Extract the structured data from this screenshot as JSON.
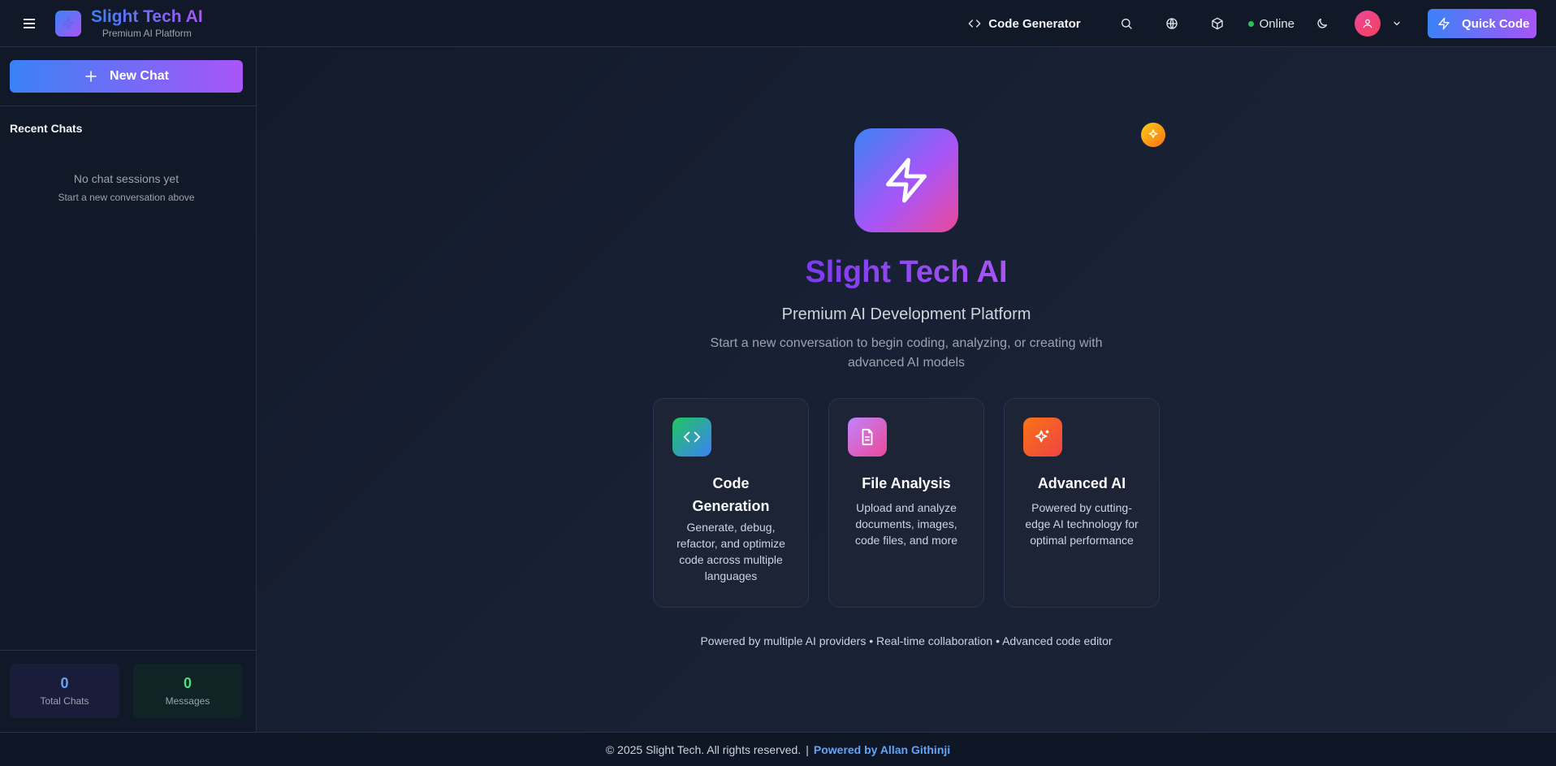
{
  "header": {
    "brand_title": "Slight Tech AI",
    "brand_subtitle": "Premium AI Platform",
    "code_generator_label": "Code Generator",
    "status_label": "Online",
    "quick_code_label": "Quick Code",
    "icons": [
      "menu-icon",
      "code-icon",
      "search-icon",
      "globe-icon",
      "box-icon",
      "moon-icon",
      "user-icon",
      "chevron-down-icon",
      "zap-icon"
    ]
  },
  "sidebar": {
    "new_chat_label": "New Chat",
    "recent_title": "Recent Chats",
    "empty_title": "No chat sessions yet",
    "empty_subtitle": "Start a new conversation above",
    "stats": [
      {
        "value": "0",
        "label": "Total Chats"
      },
      {
        "value": "0",
        "label": "Messages"
      }
    ]
  },
  "main": {
    "title": "Slight Tech AI",
    "subtitle": "Premium AI Development Platform",
    "description": "Start a new conversation to begin coding, analyzing, or creating with advanced AI models",
    "cards": [
      {
        "title": "Code Generation",
        "description": "Generate, debug, refactor, and optimize code across multiple languages",
        "icon": "code-icon"
      },
      {
        "title": "File Analysis",
        "description": "Upload and analyze documents, images, code files, and more",
        "icon": "file-text-icon"
      },
      {
        "title": "Advanced AI",
        "description": "Powered by cutting-edge AI technology for optimal performance",
        "icon": "sparkles-icon"
      }
    ],
    "tagline": "Powered by multiple AI providers • Real-time collaboration • Advanced code editor"
  },
  "footer": {
    "copyright": "© 2025 Slight Tech. All rights reserved.",
    "separator": "|",
    "credit": "Powered by Allan Githinji"
  },
  "colors": {
    "accent_blue": "#3b82f6",
    "accent_purple": "#a855f7",
    "online": "#22c55e",
    "background": "#111827"
  }
}
